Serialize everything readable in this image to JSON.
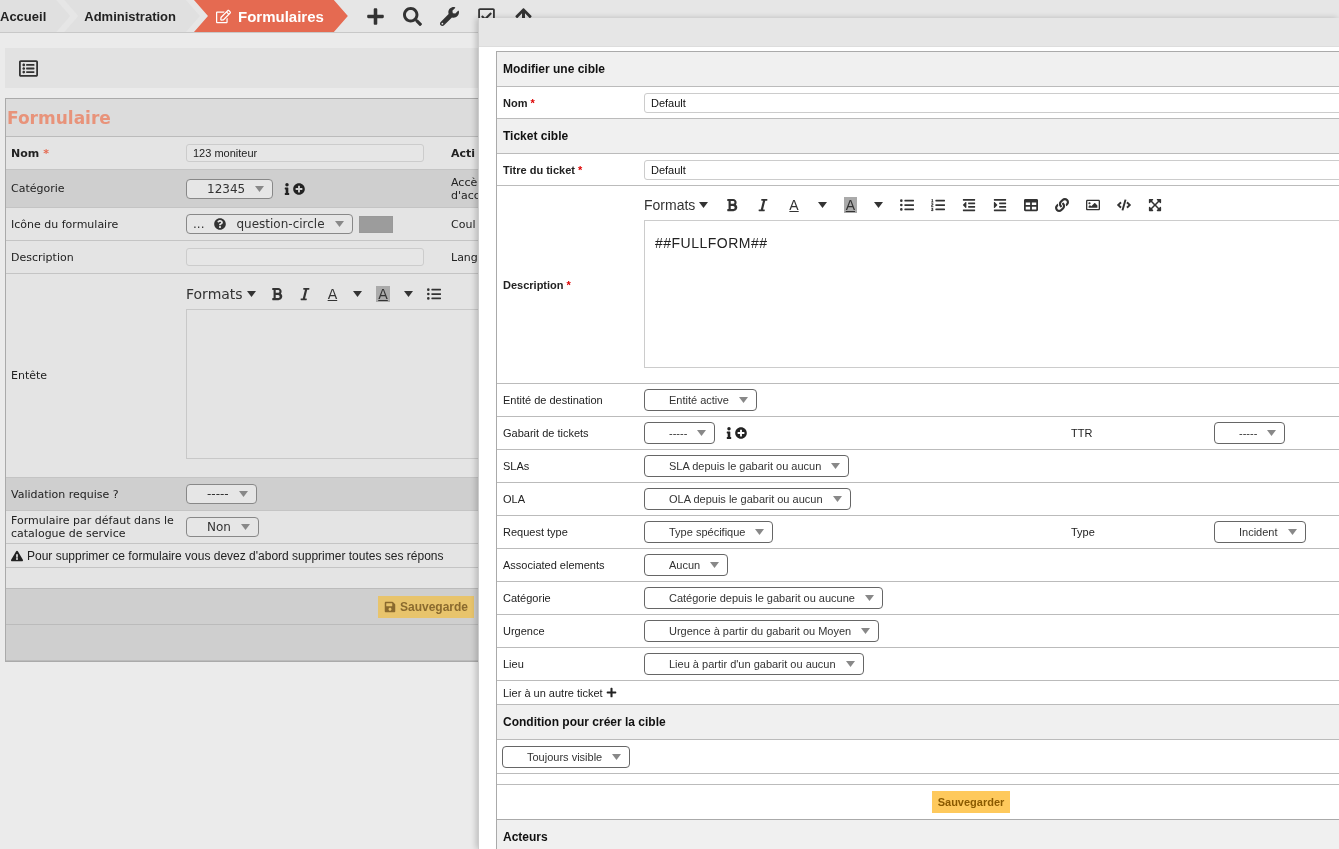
{
  "breadcrumb": [
    {
      "label": "Accueil",
      "selected": false
    },
    {
      "label": "Administration",
      "selected": false
    },
    {
      "label": "Formulaires",
      "selected": true
    }
  ],
  "form": {
    "title": "Formulaire",
    "rows": [
      {
        "kind": "input",
        "label": "Nom",
        "required_mark": "*",
        "value": "123 moniteur",
        "highlighted": false,
        "side_label": "Acti"
      },
      {
        "kind": "select",
        "label": "Catégorie",
        "value": "12345",
        "info_icons": true,
        "highlighted": true,
        "side_label": "Accè d'acc"
      },
      {
        "kind": "icon_select",
        "label": "Icône du formulaire",
        "prefix": "...",
        "value": "question-circle",
        "color": "#9c9c9c",
        "highlighted": false,
        "side_label": "Coul"
      },
      {
        "kind": "input",
        "label": "Description",
        "highlighted": false,
        "side_label": "Lang"
      },
      {
        "kind": "editor",
        "label": "Entête",
        "highlighted": false,
        "toolbar": {
          "formats": "Formats",
          "text_color": "A",
          "highlight_color": "A"
        }
      },
      {
        "kind": "select",
        "label": "Validation requise ?",
        "value": "-----",
        "highlighted": true
      },
      {
        "kind": "select",
        "label": "Formulaire par défaut dans le catalogue de service",
        "value": "Non",
        "highlighted": false
      }
    ],
    "warning": "Pour supprimer ce formulaire vous devez d'abord supprimer toutes ses répons",
    "save_button": "Sauvegarde"
  },
  "modal": {
    "rows": [
      {
        "kind": "header",
        "title": "Modifier une cible"
      },
      {
        "kind": "input",
        "label": "Nom",
        "required_mark": "*",
        "value": "Default"
      },
      {
        "kind": "header",
        "title": "Ticket cible"
      },
      {
        "kind": "input",
        "label": "Titre du ticket",
        "required_mark": "*",
        "value": "Default"
      },
      {
        "kind": "editor",
        "label": "Description",
        "required_mark": "*",
        "content": "##FULLFORM##",
        "toolbar": {
          "formats": "Formats",
          "text_color": "A",
          "highlight_color": "A"
        }
      },
      {
        "kind": "select",
        "label": "Entité de destination",
        "value": "Entité active"
      },
      {
        "kind": "select",
        "label": "Gabarit de tickets",
        "value": "-----",
        "info_icons": true,
        "side_label": "TTR",
        "side_value": "-----"
      },
      {
        "kind": "select",
        "label": "SLAs",
        "value": "SLA depuis le gabarit ou aucun"
      },
      {
        "kind": "select",
        "label": "OLA",
        "value": "OLA depuis le gabarit ou aucun"
      },
      {
        "kind": "select",
        "label": "Request type",
        "value": "Type spécifique",
        "side_label": "Type",
        "side_value": "Incident"
      },
      {
        "kind": "select",
        "label": "Associated elements",
        "value": "Aucun"
      },
      {
        "kind": "select",
        "label": "Catégorie",
        "value": "Catégorie depuis le gabarit ou aucune"
      },
      {
        "kind": "select",
        "label": "Urgence",
        "value": "Urgence à partir du gabarit ou Moyen"
      },
      {
        "kind": "select",
        "label": "Lieu",
        "value": "Lieu à partir d'un gabarit ou aucun"
      },
      {
        "kind": "link",
        "label": "Lier à un autre ticket"
      },
      {
        "kind": "header",
        "title": "Condition pour créer la cible"
      },
      {
        "kind": "wide_select",
        "value": "Toujours visible"
      },
      {
        "kind": "spacer"
      },
      {
        "kind": "save",
        "label": "Sauvegarder"
      },
      {
        "kind": "header",
        "title": "Acteurs"
      }
    ]
  }
}
